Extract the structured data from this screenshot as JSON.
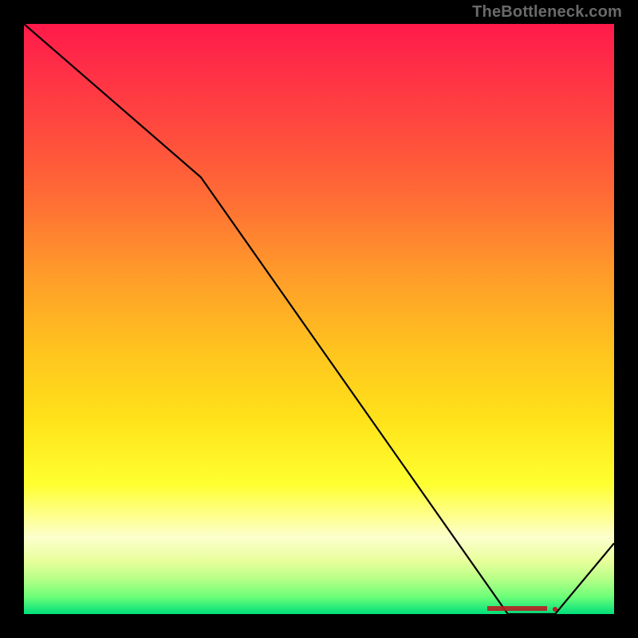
{
  "watermark": "TheBottleneck.com",
  "chart_data": {
    "type": "line",
    "title": "",
    "xlabel": "",
    "ylabel": "",
    "xlim": [
      0,
      100
    ],
    "ylim": [
      0,
      100
    ],
    "x": [
      0,
      30,
      82,
      90,
      100
    ],
    "values": [
      100,
      74,
      0,
      0,
      12
    ],
    "annotation": {
      "label": "",
      "x": 90,
      "y": 0
    },
    "background": "rainbow-vertical-gradient"
  }
}
